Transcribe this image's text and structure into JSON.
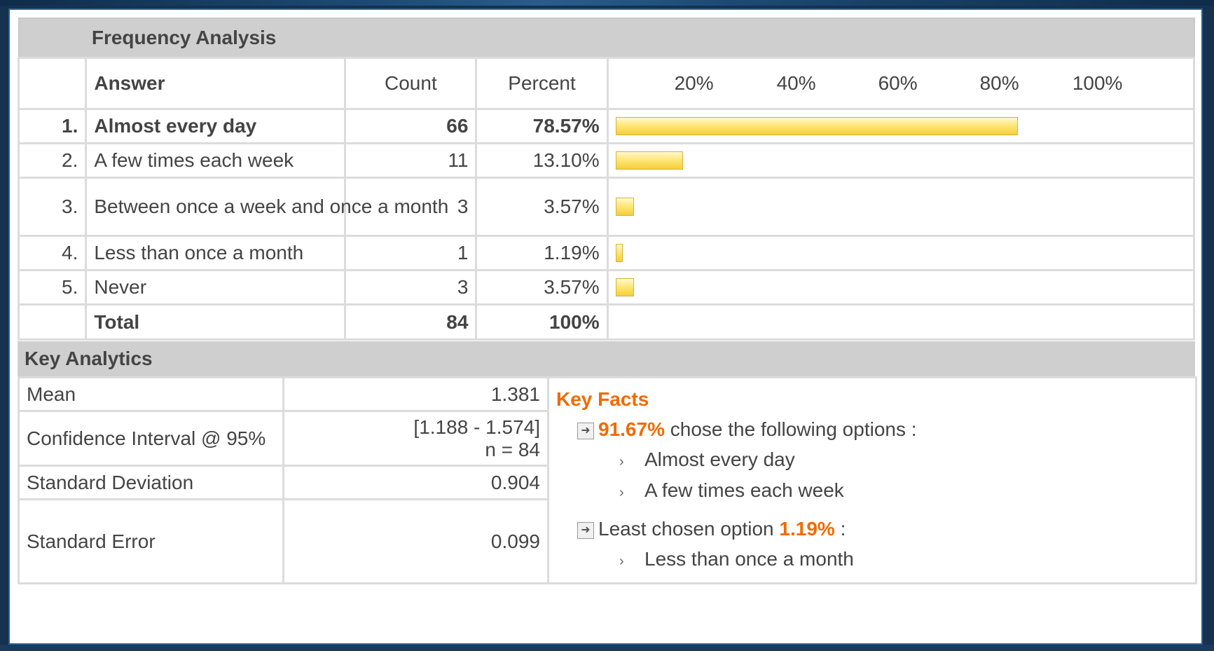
{
  "frequency": {
    "title": "Frequency Analysis",
    "headers": {
      "answer": "Answer",
      "count": "Count",
      "percent": "Percent"
    },
    "scale": [
      "20%",
      "40%",
      "60%",
      "80%",
      "100%"
    ],
    "rows": [
      {
        "num": "1.",
        "answer": "Almost every day",
        "count": "66",
        "percent": "78.57%",
        "value": 78.57
      },
      {
        "num": "2.",
        "answer": "A few times each week",
        "count": "11",
        "percent": "13.10%",
        "value": 13.1
      },
      {
        "num": "3.",
        "answer": "Between once a week and once a month",
        "count": "3",
        "percent": "3.57%",
        "value": 3.57
      },
      {
        "num": "4.",
        "answer": "Less than once a month",
        "count": "1",
        "percent": "1.19%",
        "value": 1.19
      },
      {
        "num": "5.",
        "answer": "Never",
        "count": "3",
        "percent": "3.57%",
        "value": 3.57
      }
    ],
    "total": {
      "label": "Total",
      "count": "84",
      "percent": "100%"
    },
    "bar_color": "#ffe77a"
  },
  "key_analytics": {
    "title": "Key Analytics",
    "mean": {
      "label": "Mean",
      "value": "1.381"
    },
    "ci": {
      "label": "Confidence Interval @ 95%",
      "range": "[1.188 - 1.574]",
      "n": "n = 84"
    },
    "sd": {
      "label": "Standard Deviation",
      "value": "0.904"
    },
    "se": {
      "label": "Standard Error",
      "value": "0.099"
    }
  },
  "key_facts": {
    "title": "Key Facts",
    "fact1_pct": "91.67%",
    "fact1_text": "chose the following options :",
    "fact1_items": [
      "Almost every day",
      "A few times each week"
    ],
    "fact2_text": "Least chosen option",
    "fact2_pct": "1.19%",
    "fact2_suffix": ":",
    "fact2_items": [
      "Less than once a month"
    ],
    "accent_color": "#f26a00"
  }
}
